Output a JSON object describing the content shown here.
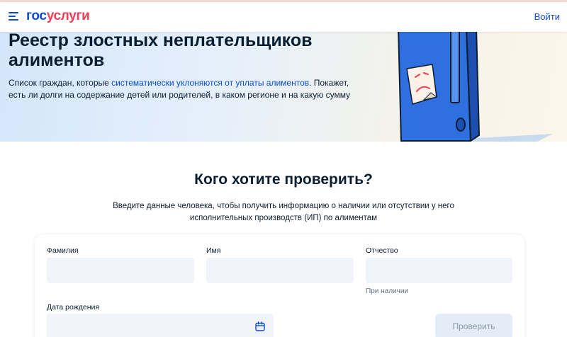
{
  "header": {
    "logo_part1": "гос",
    "logo_part2": "услуги",
    "login_label": "Войти"
  },
  "hero": {
    "title": "Реестр злостных неплательщиков алиментов",
    "desc_before": "Список граждан, которые ",
    "desc_link": "систематически уклоняются от уплаты алиментов",
    "desc_after": ". Покажет, есть ли долги на содержание детей или родителей, в каком регионе и на какую сумму"
  },
  "main": {
    "title": "Кого хотите проверить?",
    "subtitle": "Введите данные человека, чтобы получить информацию о наличии или отсутствии у него исполнительных производств (ИП) по алиментам"
  },
  "form": {
    "surname_label": "Фамилия",
    "surname_value": "",
    "name_label": "Имя",
    "name_value": "",
    "patronymic_label": "Отчество",
    "patronymic_value": "",
    "patronymic_hint": "При наличии",
    "birthdate_label": "Дата рождения",
    "birthdate_value": "",
    "submit_label": "Проверить"
  },
  "icons": {
    "menu": "menu-icon",
    "calendar": "calendar-icon",
    "illustration": "folder-sad-note-illustration"
  },
  "colors": {
    "brand_blue": "#0d4cd3",
    "brand_red": "#ee3f58",
    "input_bg": "#f0f3f7",
    "disabled_button_bg": "#e4ecf7",
    "disabled_button_text": "#8a98a8"
  }
}
